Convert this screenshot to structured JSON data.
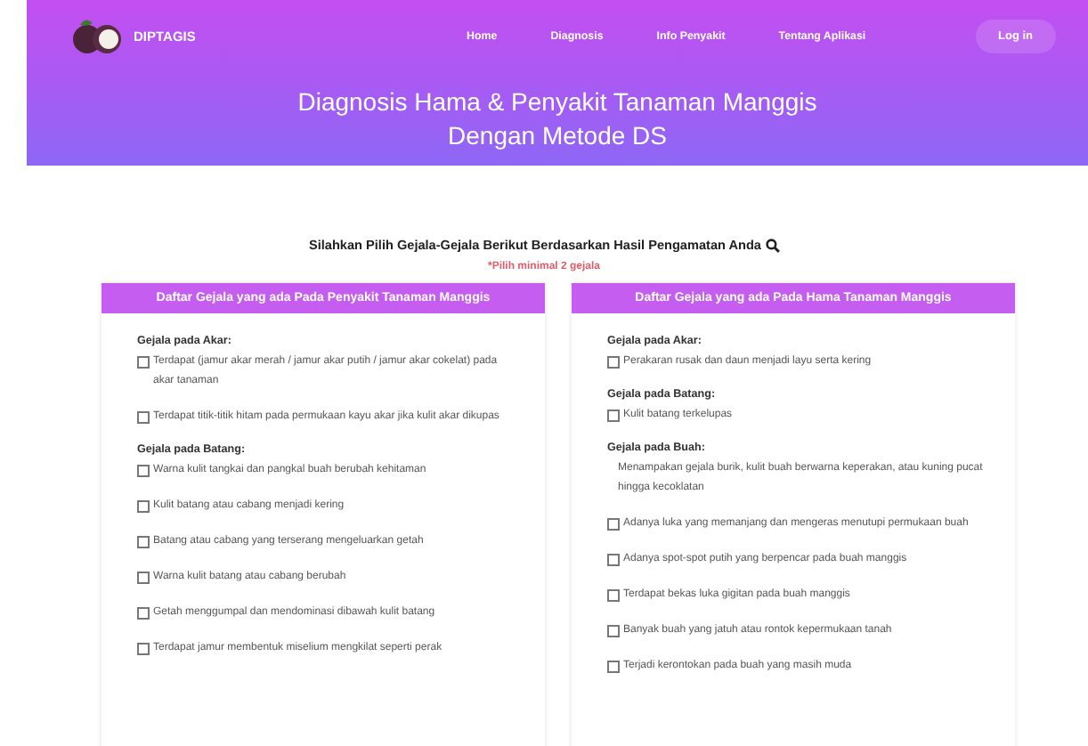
{
  "brand": "DIPTAGIS",
  "nav": [
    {
      "label": "Home"
    },
    {
      "label": "Diagnosis"
    },
    {
      "label": "Info Penyakit"
    },
    {
      "label": "Tentang Aplikasi"
    }
  ],
  "login": "Log in",
  "hero_title": [
    "Diagnosis Hama & Penyakit Tanaman Manggis",
    "Dengan Metode DS"
  ],
  "instruction": "Silahkan Pilih Gejala-Gejala Berikut Berdasarkan Hasil Pengamatan Anda",
  "note": "*Pilih minimal 2 gejala",
  "panels": [
    {
      "title": "Daftar Gejala yang ada Pada Penyakit Tanaman Manggis",
      "groups": [
        {
          "label": "Gejala pada Akar:",
          "items": [
            {
              "kind": "checkbox",
              "checked": false,
              "text": "Terdapat (jamur akar merah / jamur akar putih / jamur akar cokelat) pada akar tanaman"
            },
            {
              "kind": "checkbox",
              "checked": false,
              "text": "Terdapat titik-titik hitam pada permukaan kayu akar jika kulit akar dikupas"
            }
          ]
        },
        {
          "label": "Gejala pada Batang:",
          "items": [
            {
              "kind": "checkbox",
              "checked": false,
              "text": "Warna kulit tangkai dan pangkal buah berubah kehitaman"
            },
            {
              "kind": "checkbox",
              "checked": false,
              "text": "Kulit batang atau cabang menjadi kering"
            },
            {
              "kind": "checkbox",
              "checked": false,
              "text": "Batang atau cabang yang terserang mengeluarkan getah"
            },
            {
              "kind": "checkbox",
              "checked": false,
              "text": "Warna kulit batang atau cabang berubah"
            },
            {
              "kind": "checkbox",
              "checked": false,
              "text": "Getah menggumpal dan mendominasi dibawah kulit batang"
            },
            {
              "kind": "checkbox",
              "checked": false,
              "text": "Terdapat jamur membentuk miselium mengkilat seperti perak"
            }
          ]
        }
      ]
    },
    {
      "title": "Daftar Gejala yang ada Pada Hama Tanaman Manggis",
      "groups": [
        {
          "label": "Gejala pada Akar:",
          "items": [
            {
              "kind": "checkbox",
              "checked": false,
              "text": "Perakaran rusak dan daun menjadi layu serta kering"
            }
          ]
        },
        {
          "label": "Gejala pada Batang:",
          "items": [
            {
              "kind": "checkbox",
              "checked": false,
              "text": "Kulit batang terkelupas"
            }
          ]
        },
        {
          "label": "Gejala pada Buah:",
          "items": [
            {
              "kind": "plain",
              "text": "Menampakan gejala burik, kulit buah berwarna keperakan, atau kuning pucat hingga kecoklatan"
            },
            {
              "kind": "checkbox",
              "checked": false,
              "text": "Adanya luka yang memanjang dan mengeras menutupi permukaan buah"
            },
            {
              "kind": "checkbox",
              "checked": false,
              "text": "Adanya spot-spot putih yang berpencar pada buah manggis"
            },
            {
              "kind": "checkbox",
              "checked": false,
              "text": "Terdapat bekas luka gigitan pada buah manggis"
            },
            {
              "kind": "checkbox",
              "checked": false,
              "text": "Banyak buah yang jatuh atau rontok kepermukaan tanah"
            },
            {
              "kind": "checkbox",
              "checked": false,
              "text": "Terjadi kerontokan pada buah yang masih muda"
            }
          ]
        }
      ]
    }
  ]
}
